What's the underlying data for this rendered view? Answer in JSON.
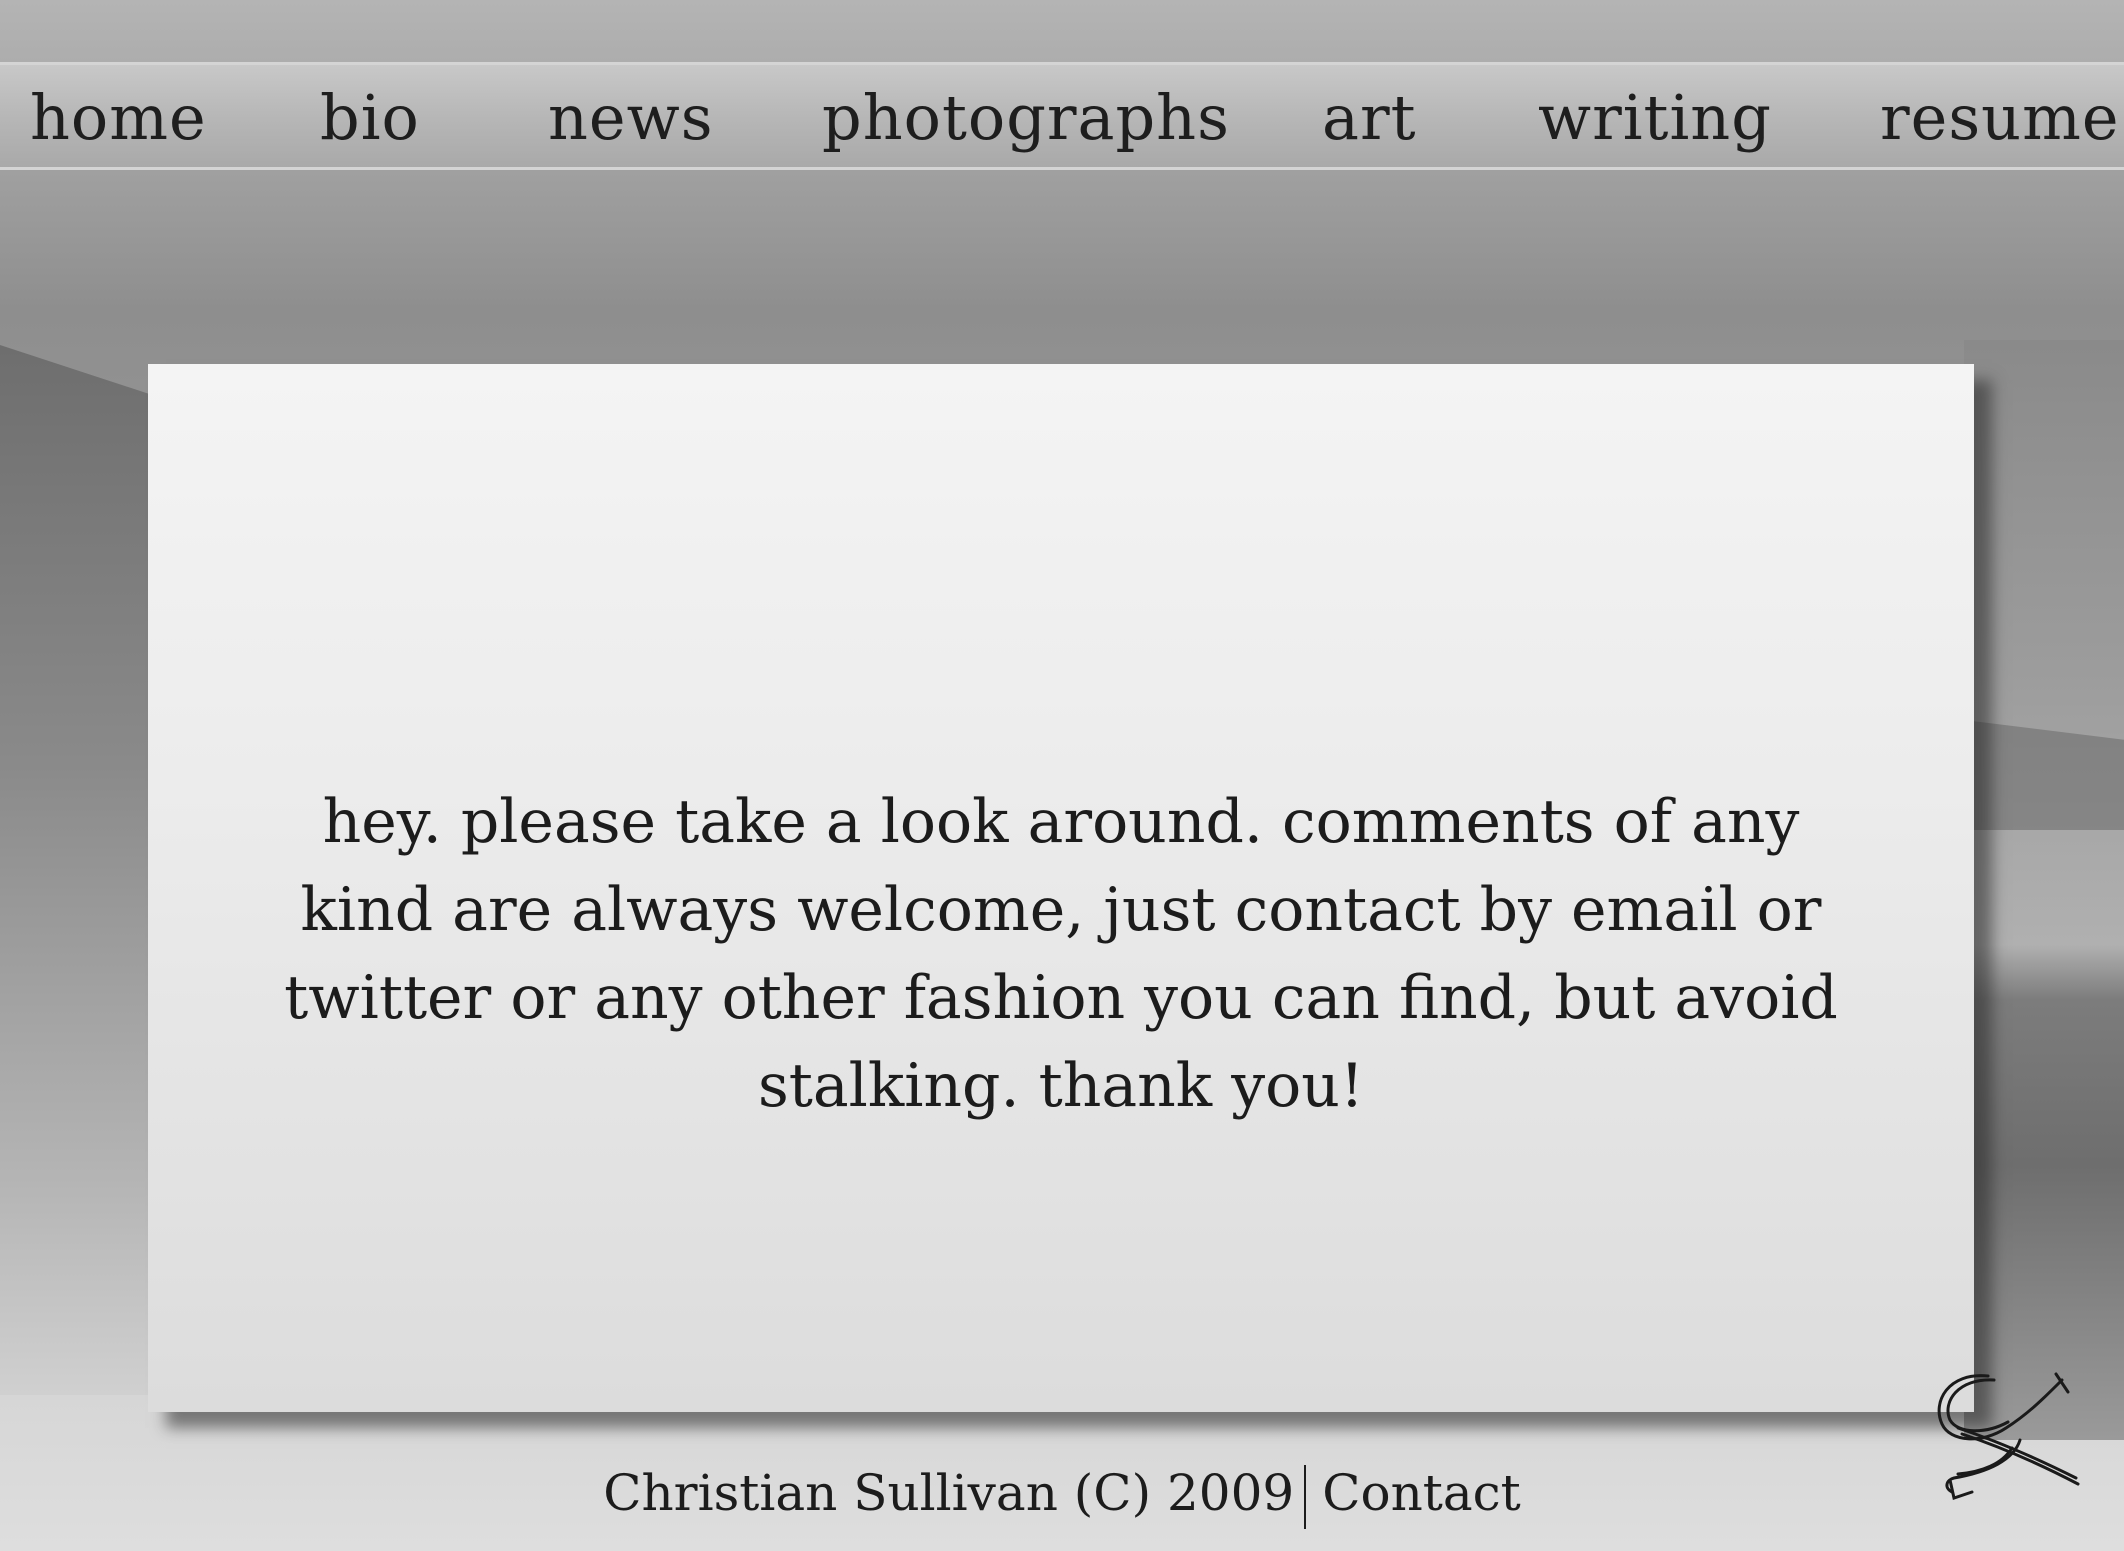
{
  "nav": {
    "items": [
      {
        "label": "home"
      },
      {
        "label": "bio"
      },
      {
        "label": "news"
      },
      {
        "label": "photographs"
      },
      {
        "label": "art"
      },
      {
        "label": "writing"
      },
      {
        "label": "resume"
      }
    ]
  },
  "main": {
    "message": "hey. please take a look around. comments of any kind are always welcome, just contact by email or twitter or any other fashion you can find, but avoid stalking. thank you!"
  },
  "footer": {
    "copyright": "Christian Sullivan (C) 2009",
    "contact_label": "Contact"
  },
  "icons": {
    "signature": "signature-logo-icon"
  }
}
